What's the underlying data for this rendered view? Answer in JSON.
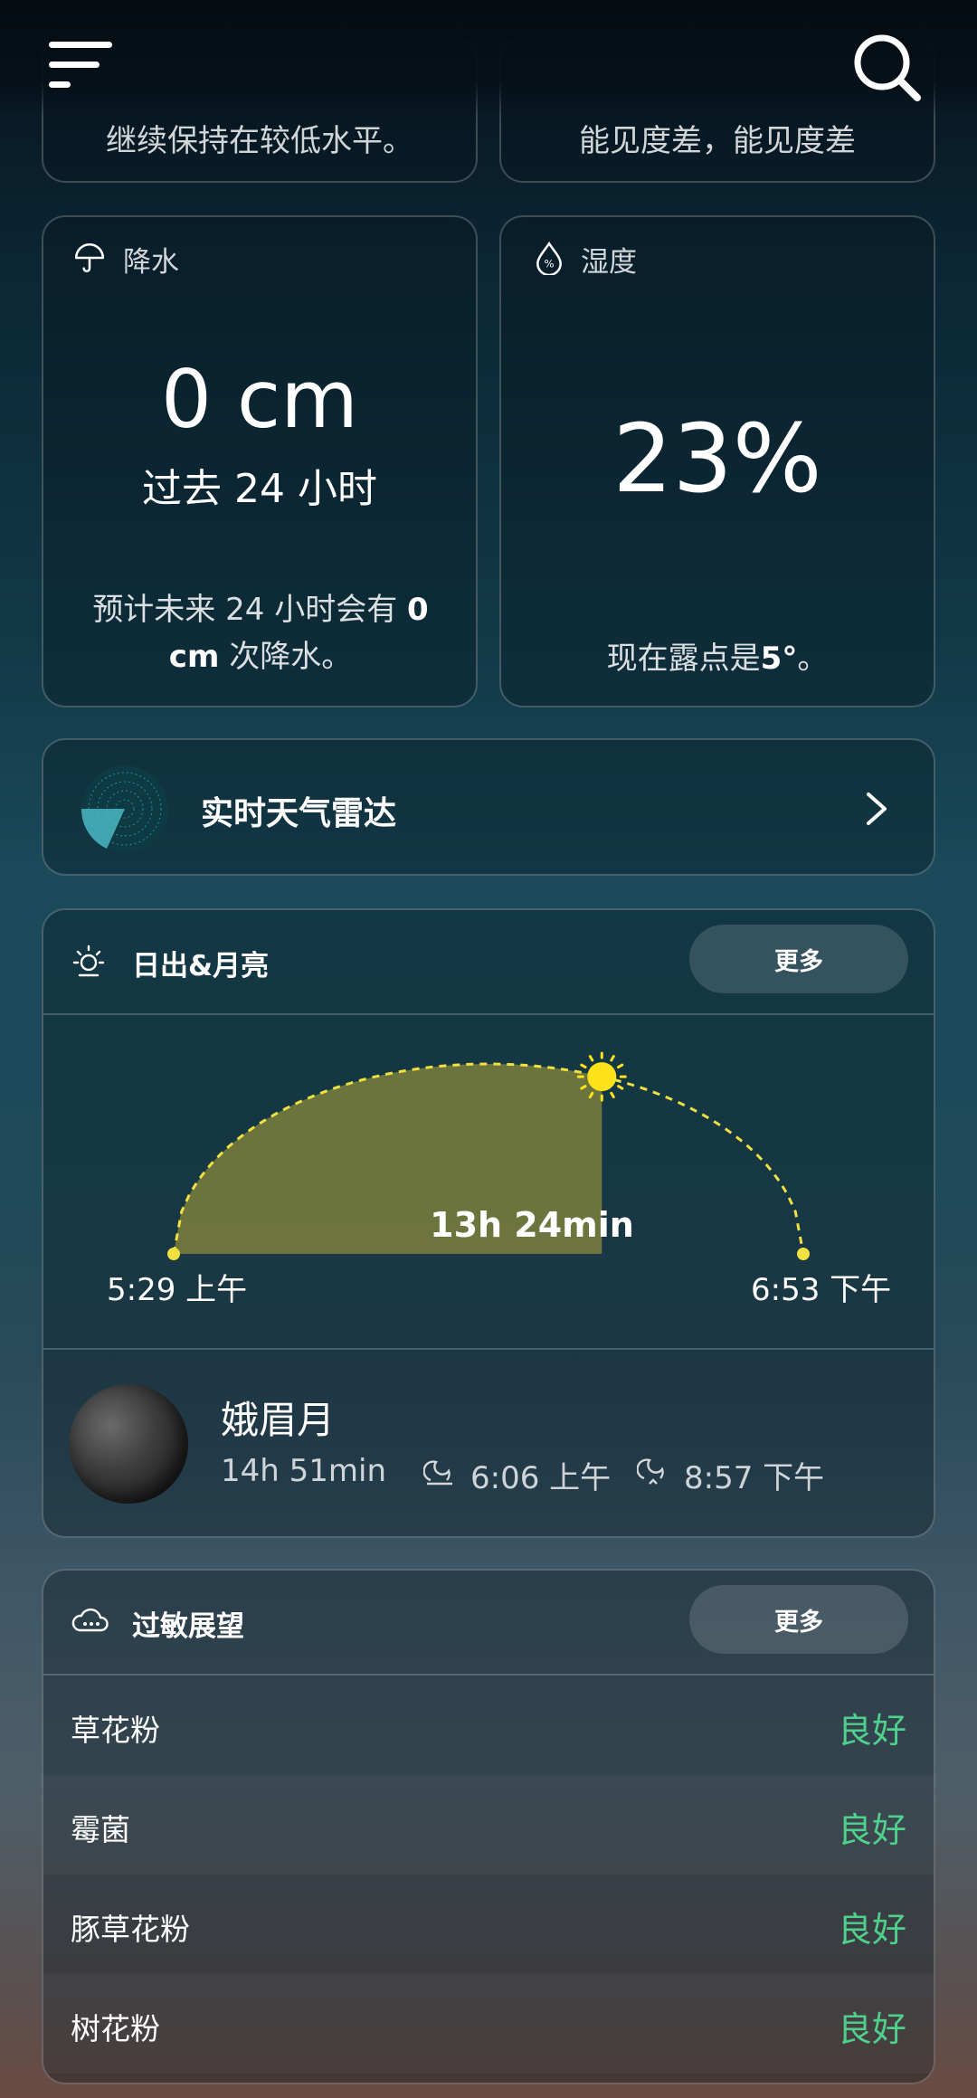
{
  "top_cards": {
    "left_text": "继续保持在较低水平。",
    "right_text": "能见度差，能见度差"
  },
  "precipitation": {
    "title": "降水",
    "value": "0 cm",
    "period": "过去 24 小时",
    "forecast_prefix": "预计未来 24 小时会有 ",
    "forecast_value": "0 cm",
    "forecast_suffix": " 次降水。"
  },
  "humidity": {
    "title": "湿度",
    "value": "23%",
    "dew_prefix": "现在露点是",
    "dew_value": "5°",
    "dew_suffix": "。"
  },
  "radar": {
    "label": "实时天气雷达"
  },
  "sun_moon": {
    "title": "日出&月亮",
    "more_label": "更多",
    "sunrise": "5:29 上午",
    "sunset": "6:53 下午",
    "daylight": "13h 24min",
    "sun_progress": 0.68,
    "moon_phase": "娥眉月",
    "moon_duration": "14h 51min",
    "moonrise": "6:06 上午",
    "moonset": "8:57 下午",
    "colors": {
      "arc": "#f0e040",
      "fill": "#8a8a3c",
      "sun": "#ffe21a"
    }
  },
  "allergy": {
    "title": "过敏展望",
    "more_label": "更多",
    "items": [
      {
        "label": "草花粉",
        "value": "良好"
      },
      {
        "label": "霉菌",
        "value": "良好"
      },
      {
        "label": "豚草花粉",
        "value": "良好"
      },
      {
        "label": "树花粉",
        "value": "良好"
      }
    ],
    "good_color": "#4fd08c"
  },
  "icons": {
    "menu": "menu-icon",
    "search": "search-icon",
    "umbrella": "umbrella-icon",
    "droplet": "humidity-drop-icon",
    "radar": "radar-icon",
    "chevron": "chevron-right-icon",
    "sun": "sun-icon",
    "cloud": "allergy-cloud-icon",
    "moonrise": "moonrise-icon",
    "moonset": "moonset-icon"
  }
}
